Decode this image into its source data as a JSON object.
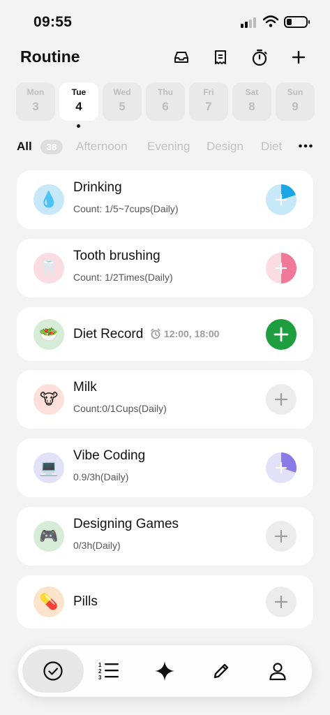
{
  "status": {
    "time": "09:55"
  },
  "header": {
    "title": "Routine",
    "icons": [
      "inbox-icon",
      "receipt-icon",
      "timer-icon",
      "plus-icon"
    ]
  },
  "days": [
    {
      "name": "Mon",
      "num": "3",
      "active": false
    },
    {
      "name": "Tue",
      "num": "4",
      "active": true
    },
    {
      "name": "Wed",
      "num": "5",
      "active": false
    },
    {
      "name": "Thu",
      "num": "6",
      "active": false
    },
    {
      "name": "Fri",
      "num": "7",
      "active": false
    },
    {
      "name": "Sat",
      "num": "8",
      "active": false
    },
    {
      "name": "Sun",
      "num": "9",
      "active": false
    }
  ],
  "filters": {
    "all_label": "All",
    "all_count": "38",
    "tabs": [
      "Afternoon",
      "Evening",
      "Design",
      "Diet"
    ]
  },
  "items": [
    {
      "emoji": "💧",
      "title": "Drinking",
      "sub": "Count: 1/5~7cups(Daily)",
      "progress": 0.2,
      "color": "#1aa7e8"
    },
    {
      "emoji": "🦷",
      "title": "Tooth brushing",
      "sub": "Count: 1/2Times(Daily)",
      "progress": 0.5,
      "color": "#f0799a"
    },
    {
      "emoji": "🥗",
      "title": "Diet Record",
      "reminder": "12:00, 18:00",
      "action": "green-add"
    },
    {
      "emoji": "🐮",
      "title": "Milk",
      "sub": "Count:0/1Cups(Daily)",
      "progress": 0
    },
    {
      "emoji": "💻",
      "title": "Vibe Coding",
      "sub": "0.9/3h(Daily)",
      "progress": 0.3,
      "color": "#8b7be8"
    },
    {
      "emoji": "🎮",
      "title": "Designing Games",
      "sub": "0/3h(Daily)",
      "progress": 0
    },
    {
      "emoji": "💊",
      "title": "Pills",
      "progress": 0
    }
  ],
  "colors": {
    "accent_green": "#1f9e3f",
    "drinking_bg": "#c6e8f8",
    "tooth_bg": "#fbdce3",
    "diet_bg": "#d6ecd6",
    "milk_bg": "#fde0dc",
    "coding_bg": "#e3e1f8",
    "games_bg": "#d6ecd6",
    "pills_bg": "#fbe3cc"
  },
  "bottom_nav": [
    "check-circle-icon",
    "numbered-list-icon",
    "sparkle-icon",
    "pencil-icon",
    "user-icon"
  ]
}
